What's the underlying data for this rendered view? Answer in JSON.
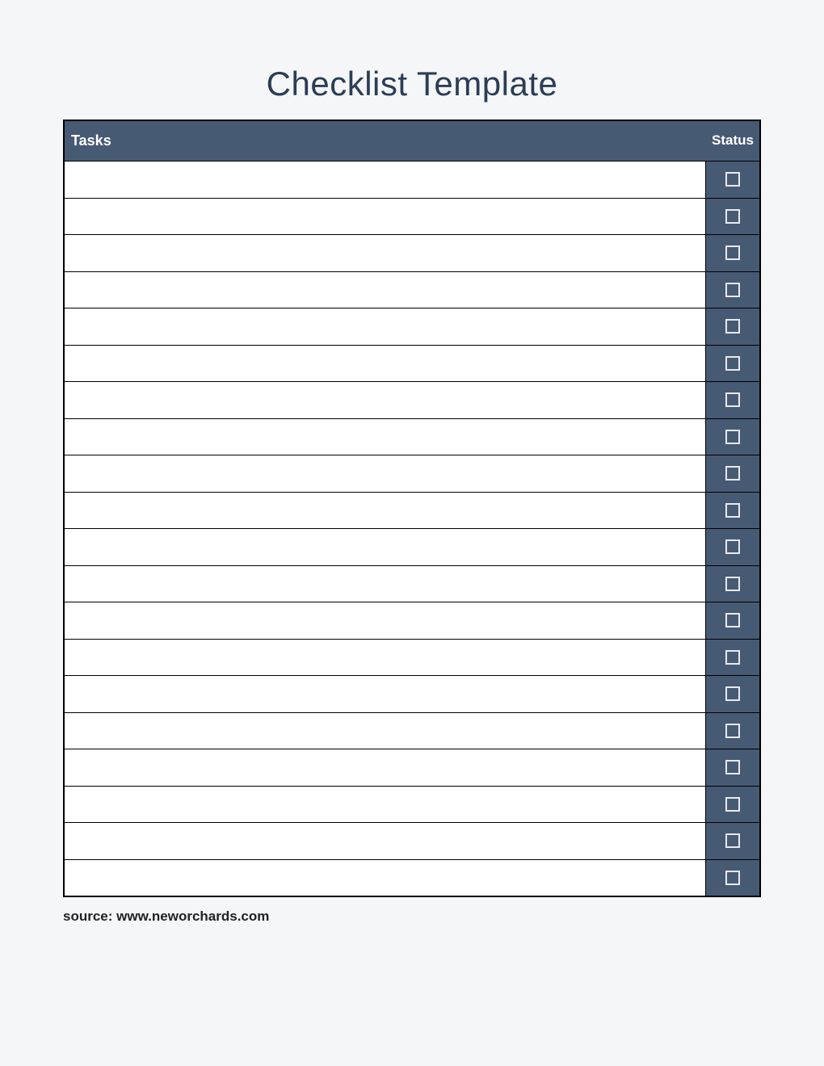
{
  "title": "Checklist Template",
  "columns": {
    "tasks": "Tasks",
    "status": "Status"
  },
  "rows": [
    {
      "task": "",
      "checked": false
    },
    {
      "task": "",
      "checked": false
    },
    {
      "task": "",
      "checked": false
    },
    {
      "task": "",
      "checked": false
    },
    {
      "task": "",
      "checked": false
    },
    {
      "task": "",
      "checked": false
    },
    {
      "task": "",
      "checked": false
    },
    {
      "task": "",
      "checked": false
    },
    {
      "task": "",
      "checked": false
    },
    {
      "task": "",
      "checked": false
    },
    {
      "task": "",
      "checked": false
    },
    {
      "task": "",
      "checked": false
    },
    {
      "task": "",
      "checked": false
    },
    {
      "task": "",
      "checked": false
    },
    {
      "task": "",
      "checked": false
    },
    {
      "task": "",
      "checked": false
    },
    {
      "task": "",
      "checked": false
    },
    {
      "task": "",
      "checked": false
    },
    {
      "task": "",
      "checked": false
    },
    {
      "task": "",
      "checked": false
    }
  ],
  "source": "source: www.neworchards.com",
  "colors": {
    "header_bg": "#475a74",
    "title_color": "#2b3d56",
    "page_bg": "#f5f6f7"
  }
}
